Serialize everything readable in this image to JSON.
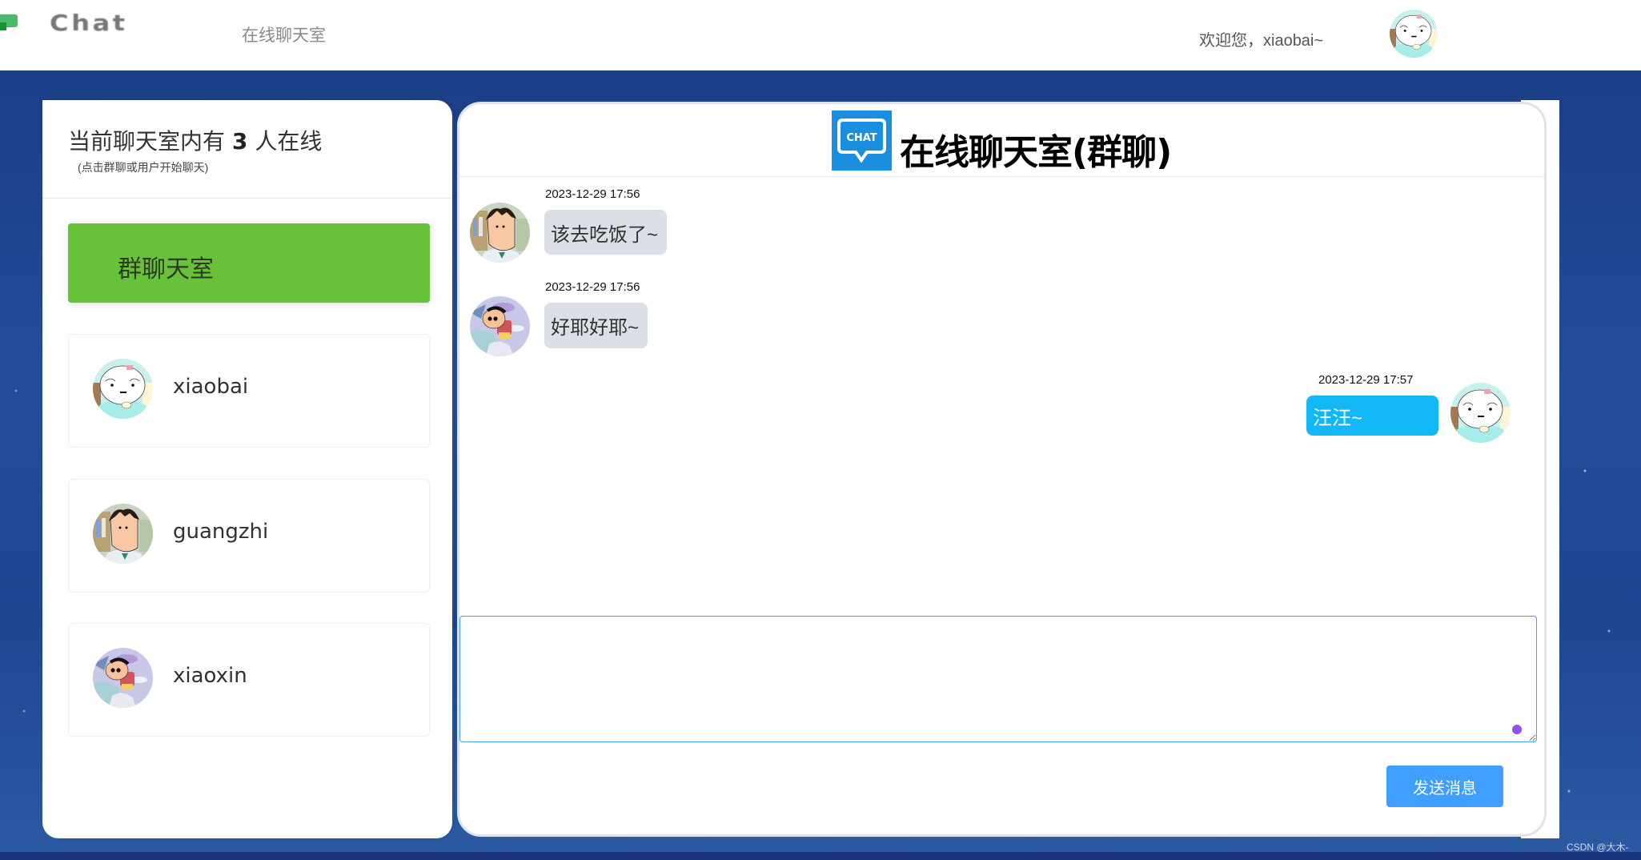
{
  "topbar": {
    "logo_text": "Chat",
    "nav_link": "在线聊天室",
    "welcome": "欢迎您，xiaobai~",
    "current_user_avatar": "xiaobai-avatar"
  },
  "sidebar": {
    "title_prefix": "当前聊天室内有",
    "online_count": "3",
    "title_suffix": "人在线",
    "hint": "(点击群聊或用户开始聊天)",
    "group_button": "群聊天室",
    "group_color": "#67c23a",
    "users": [
      {
        "name": "xiaobai",
        "avatar": "xiaobai-avatar"
      },
      {
        "name": "guangzhi",
        "avatar": "guangzhi-avatar"
      },
      {
        "name": "xiaoxin",
        "avatar": "xiaoxin-avatar"
      }
    ]
  },
  "chat": {
    "icon_label": "CHAT",
    "title": "在线聊天室(群聊)",
    "messages": [
      {
        "sender": "guangzhi",
        "time": "2023-12-29 17:56",
        "text": "该去吃饭了~",
        "self": false
      },
      {
        "sender": "xiaoxin",
        "time": "2023-12-29 17:56",
        "text": "好耶好耶~",
        "self": false
      },
      {
        "sender": "xiaobai",
        "time": "2023-12-29 17:57",
        "text": "汪汪~",
        "self": true
      }
    ],
    "input_value": "",
    "send_button": "发送消息",
    "self_bubble_color": "#12b7f5",
    "other_bubble_color": "#dcdfe6",
    "send_color": "#409eff"
  },
  "watermark": "CSDN @大木-"
}
